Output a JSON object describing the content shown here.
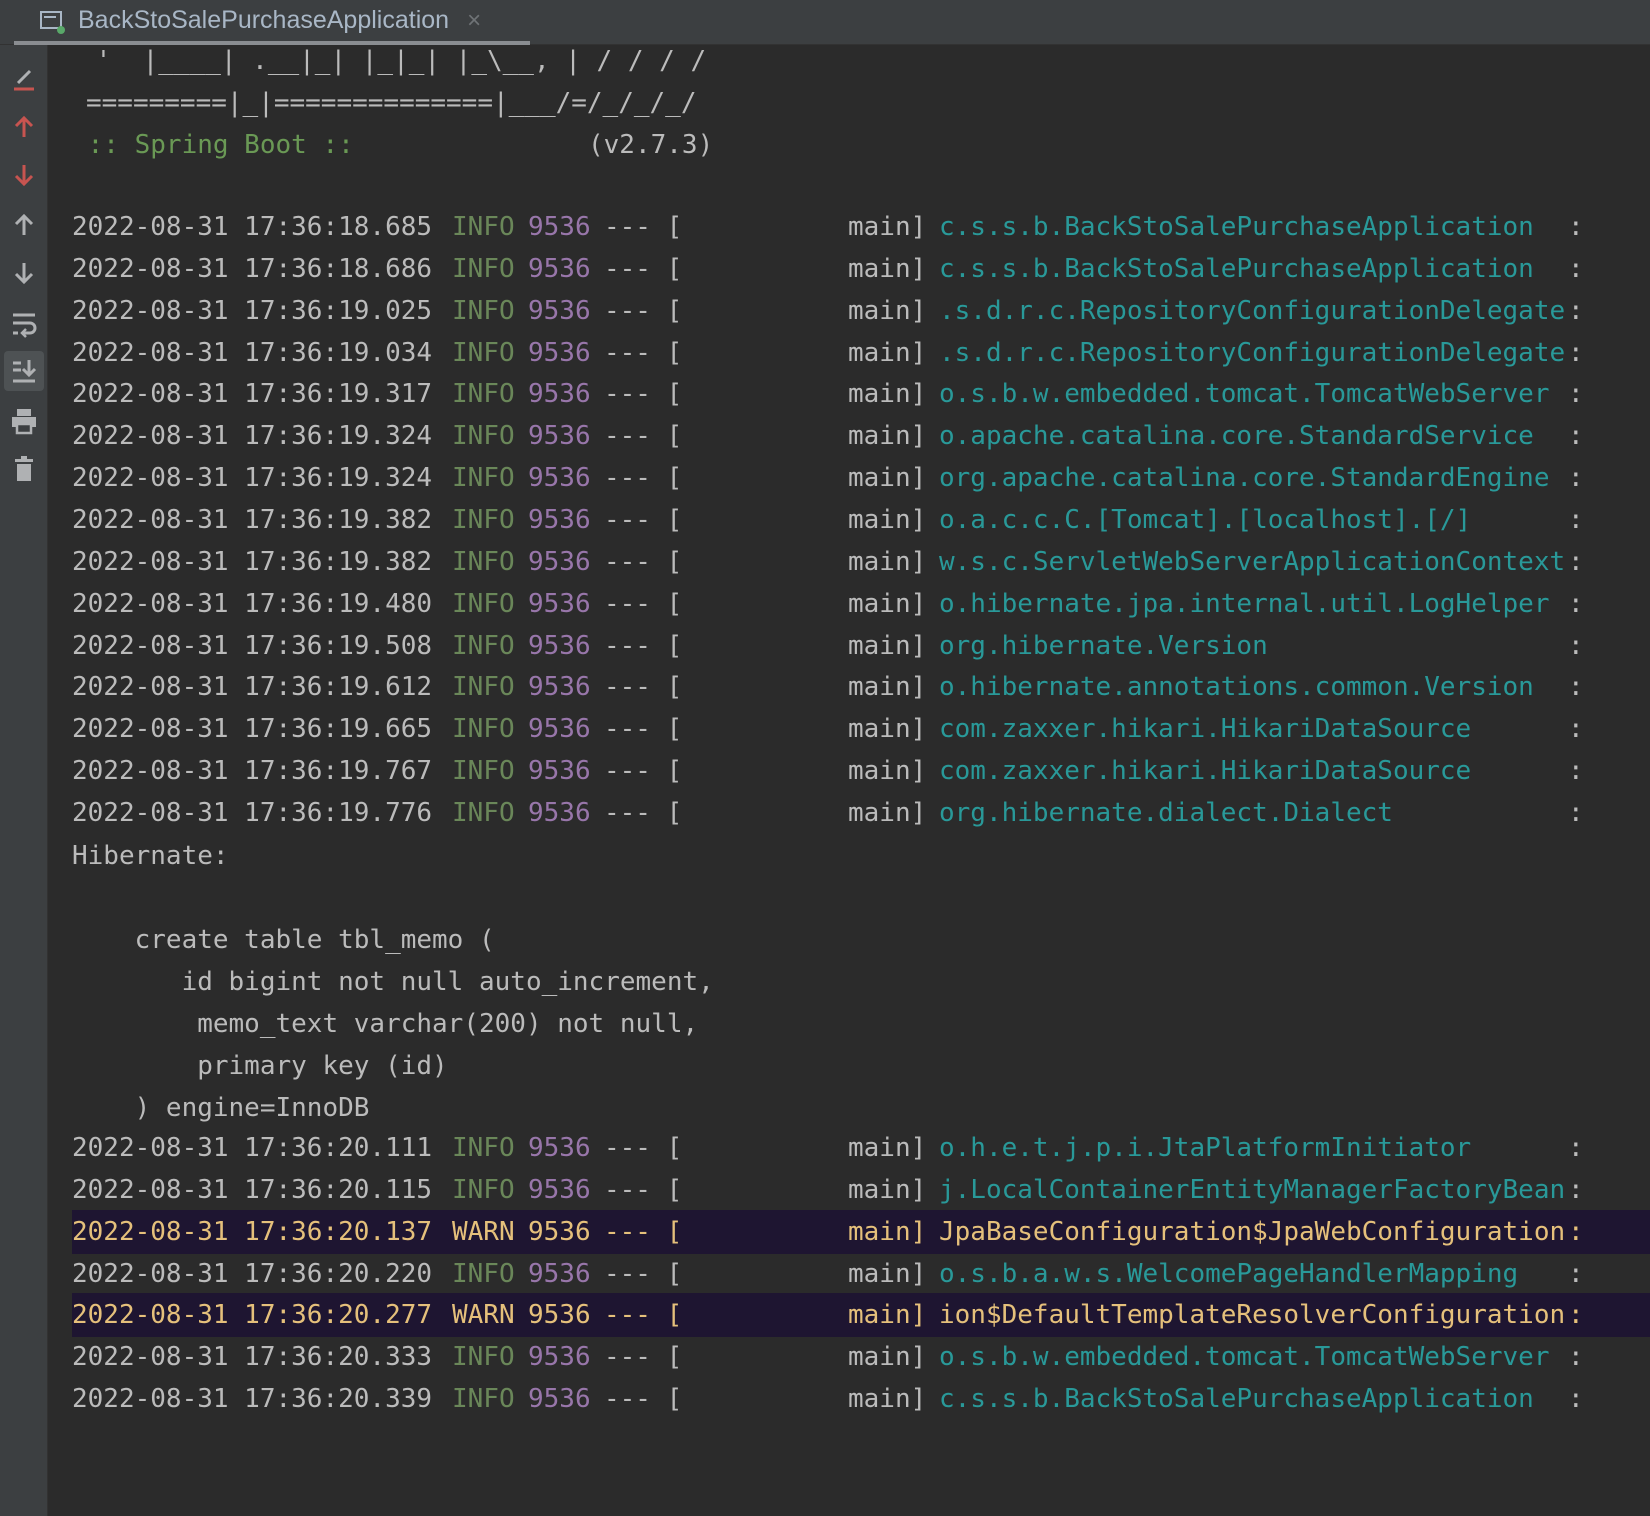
{
  "tab": {
    "title": "BackStoSalePurchaseApplication",
    "icon": "console-icon",
    "close": "×"
  },
  "toolbar": {
    "items": [
      {
        "name": "clear-icon",
        "color": "#c75450"
      },
      {
        "name": "up-stack-trace-icon",
        "color": "#c75450"
      },
      {
        "name": "down-stack-trace-icon",
        "color": "#c75450"
      },
      {
        "name": "arrow-up-icon",
        "color": "#afb1b3"
      },
      {
        "name": "arrow-down-icon",
        "color": "#afb1b3"
      },
      {
        "name": "soft-wrap-icon",
        "color": "#afb1b3"
      },
      {
        "name": "scroll-to-end-icon",
        "color": "#afb1b3"
      },
      {
        "name": "print-icon",
        "color": "#afb1b3"
      },
      {
        "name": "trash-icon",
        "color": "#afb1b3"
      }
    ]
  },
  "banner": {
    "line1": " '  |____| .__|_| |_|_| |_\\__, | / / / /",
    "line2": "=========|_|==============|___/=/_/_/_/",
    "spring_label": " :: Spring Boot :: ",
    "version": "(v2.7.3)"
  },
  "log_lines": [
    {
      "ts": "2022-08-31 17:36:18.685",
      "level": "INFO",
      "pid": "9536",
      "sep": "--- [",
      "thread": "main]",
      "logger": "c.s.s.b.BackStoSalePurchaseApplication",
      "tail": ":"
    },
    {
      "ts": "2022-08-31 17:36:18.686",
      "level": "INFO",
      "pid": "9536",
      "sep": "--- [",
      "thread": "main]",
      "logger": "c.s.s.b.BackStoSalePurchaseApplication",
      "tail": ":"
    },
    {
      "ts": "2022-08-31 17:36:19.025",
      "level": "INFO",
      "pid": "9536",
      "sep": "--- [",
      "thread": "main]",
      "logger": ".s.d.r.c.RepositoryConfigurationDelegate",
      "tail": ":"
    },
    {
      "ts": "2022-08-31 17:36:19.034",
      "level": "INFO",
      "pid": "9536",
      "sep": "--- [",
      "thread": "main]",
      "logger": ".s.d.r.c.RepositoryConfigurationDelegate",
      "tail": ":"
    },
    {
      "ts": "2022-08-31 17:36:19.317",
      "level": "INFO",
      "pid": "9536",
      "sep": "--- [",
      "thread": "main]",
      "logger": "o.s.b.w.embedded.tomcat.TomcatWebServer",
      "tail": ":"
    },
    {
      "ts": "2022-08-31 17:36:19.324",
      "level": "INFO",
      "pid": "9536",
      "sep": "--- [",
      "thread": "main]",
      "logger": "o.apache.catalina.core.StandardService",
      "tail": ":"
    },
    {
      "ts": "2022-08-31 17:36:19.324",
      "level": "INFO",
      "pid": "9536",
      "sep": "--- [",
      "thread": "main]",
      "logger": "org.apache.catalina.core.StandardEngine",
      "tail": ":"
    },
    {
      "ts": "2022-08-31 17:36:19.382",
      "level": "INFO",
      "pid": "9536",
      "sep": "--- [",
      "thread": "main]",
      "logger": "o.a.c.c.C.[Tomcat].[localhost].[/]",
      "tail": ":"
    },
    {
      "ts": "2022-08-31 17:36:19.382",
      "level": "INFO",
      "pid": "9536",
      "sep": "--- [",
      "thread": "main]",
      "logger": "w.s.c.ServletWebServerApplicationContext",
      "tail": ":"
    },
    {
      "ts": "2022-08-31 17:36:19.480",
      "level": "INFO",
      "pid": "9536",
      "sep": "--- [",
      "thread": "main]",
      "logger": "o.hibernate.jpa.internal.util.LogHelper",
      "tail": ":"
    },
    {
      "ts": "2022-08-31 17:36:19.508",
      "level": "INFO",
      "pid": "9536",
      "sep": "--- [",
      "thread": "main]",
      "logger": "org.hibernate.Version",
      "tail": ":"
    },
    {
      "ts": "2022-08-31 17:36:19.612",
      "level": "INFO",
      "pid": "9536",
      "sep": "--- [",
      "thread": "main]",
      "logger": "o.hibernate.annotations.common.Version",
      "tail": ":"
    },
    {
      "ts": "2022-08-31 17:36:19.665",
      "level": "INFO",
      "pid": "9536",
      "sep": "--- [",
      "thread": "main]",
      "logger": "com.zaxxer.hikari.HikariDataSource",
      "tail": ":"
    },
    {
      "ts": "2022-08-31 17:36:19.767",
      "level": "INFO",
      "pid": "9536",
      "sep": "--- [",
      "thread": "main]",
      "logger": "com.zaxxer.hikari.HikariDataSource",
      "tail": ":"
    },
    {
      "ts": "2022-08-31 17:36:19.776",
      "level": "INFO",
      "pid": "9536",
      "sep": "--- [",
      "thread": "main]",
      "logger": "org.hibernate.dialect.Dialect",
      "tail": ":"
    }
  ],
  "sql_block": {
    "header": "Hibernate: ",
    "blank": "    ",
    "lines": [
      "    create table tbl_memo (",
      "       id bigint not null auto_increment,",
      "        memo_text varchar(200) not null,",
      "        primary key (id)",
      "    ) engine=InnoDB"
    ]
  },
  "log_lines_2": [
    {
      "ts": "2022-08-31 17:36:20.111",
      "level": "INFO",
      "pid": "9536",
      "sep": "--- [",
      "thread": "main]",
      "logger": "o.h.e.t.j.p.i.JtaPlatformInitiator",
      "tail": ":"
    },
    {
      "ts": "2022-08-31 17:36:20.115",
      "level": "INFO",
      "pid": "9536",
      "sep": "--- [",
      "thread": "main]",
      "logger": "j.LocalContainerEntityManagerFactoryBean",
      "tail": ":"
    },
    {
      "ts": "2022-08-31 17:36:20.137",
      "level": "WARN",
      "pid": "9536",
      "sep": "--- [",
      "thread": "main]",
      "logger": "JpaBaseConfiguration$JpaWebConfiguration",
      "tail": ":"
    },
    {
      "ts": "2022-08-31 17:36:20.220",
      "level": "INFO",
      "pid": "9536",
      "sep": "--- [",
      "thread": "main]",
      "logger": "o.s.b.a.w.s.WelcomePageHandlerMapping",
      "tail": ":"
    },
    {
      "ts": "2022-08-31 17:36:20.277",
      "level": "WARN",
      "pid": "9536",
      "sep": "--- [",
      "thread": "main]",
      "logger": "ion$DefaultTemplateResolverConfiguration",
      "tail": ":"
    },
    {
      "ts": "2022-08-31 17:36:20.333",
      "level": "INFO",
      "pid": "9536",
      "sep": "--- [",
      "thread": "main]",
      "logger": "o.s.b.w.embedded.tomcat.TomcatWebServer",
      "tail": ":"
    },
    {
      "ts": "2022-08-31 17:36:20.339",
      "level": "INFO",
      "pid": "9536",
      "sep": "--- [",
      "thread": "main]",
      "logger": "c.s.s.b.BackStoSalePurchaseApplication",
      "tail": ":"
    }
  ],
  "colors": {
    "info": "#6a8759",
    "warn": "#e5c07b",
    "pid": "#9876aa",
    "logger": "#299999",
    "warn_row_bg": "#1e1531"
  }
}
